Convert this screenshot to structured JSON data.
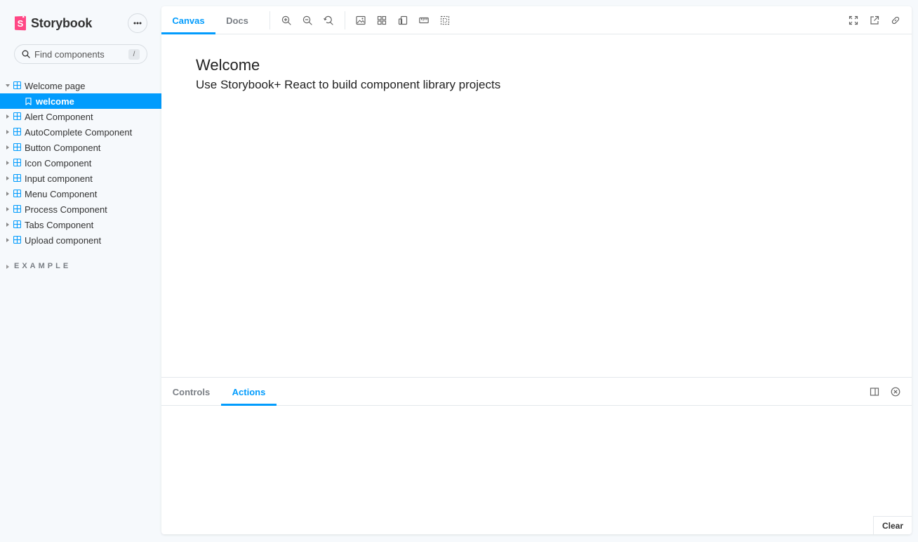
{
  "brand": {
    "name": "Storybook",
    "logo_icon": "storybook-logo-icon",
    "accent": "#ff4785"
  },
  "menu": {
    "icon": "ellipsis-icon"
  },
  "search": {
    "placeholder": "Find components",
    "shortcut": "/"
  },
  "sidebar": {
    "items": [
      {
        "label": "Welcome page",
        "expanded": true
      },
      {
        "label": "welcome",
        "selected": true,
        "type": "story"
      },
      {
        "label": "Alert Component"
      },
      {
        "label": "AutoComplete Component"
      },
      {
        "label": "Button Component"
      },
      {
        "label": "Icon Component"
      },
      {
        "label": "Input component"
      },
      {
        "label": "Menu Component"
      },
      {
        "label": "Process Component"
      },
      {
        "label": "Tabs Component"
      },
      {
        "label": "Upload component"
      }
    ],
    "group": "EXAMPLE"
  },
  "toolbar": {
    "tabs": [
      {
        "label": "Canvas",
        "active": true
      },
      {
        "label": "Docs"
      }
    ],
    "left_icons": [
      "zoom-in-icon",
      "zoom-out-icon",
      "zoom-reset-icon",
      "background-icon",
      "grid-icon",
      "viewport-icon",
      "measure-icon",
      "outline-icon"
    ],
    "right_icons": [
      "fullscreen-icon",
      "open-new-tab-icon",
      "copy-link-icon"
    ]
  },
  "canvas": {
    "title": "Welcome",
    "subtitle": "Use Storybook+ React to build component library projects"
  },
  "addons": {
    "tabs": [
      {
        "label": "Controls"
      },
      {
        "label": "Actions",
        "active": true
      }
    ],
    "clear_label": "Clear"
  },
  "colors": {
    "accent": "#029cfd",
    "background": "#f6f9fc",
    "text": "#333333",
    "muted": "#7a7f85"
  }
}
